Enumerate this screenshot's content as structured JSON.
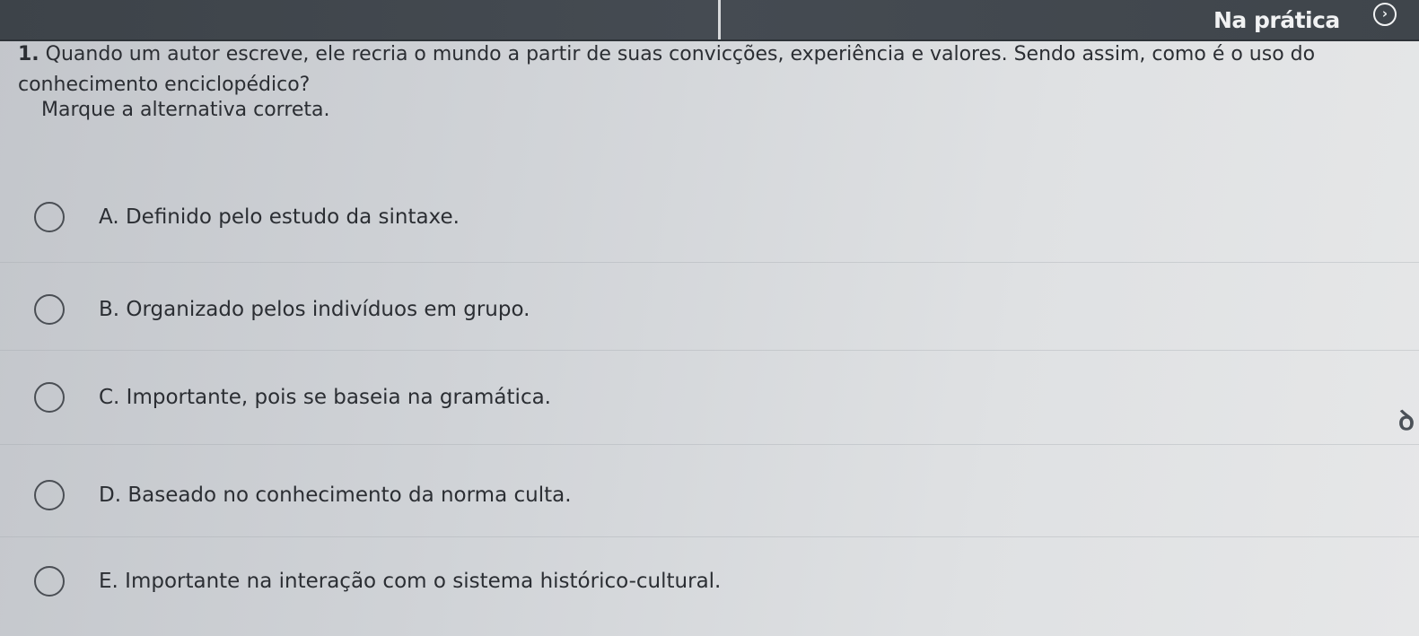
{
  "header": {
    "tab_label": "Na prática",
    "next_icon": "chevron-right-icon"
  },
  "question": {
    "number": "1.",
    "text": "Quando um autor escreve, ele recria o mundo a partir de suas convicções, experiência e valores. Sendo assim, como é o uso do conhecimento enciclopédico?",
    "instruction": "Marque a alternativa correta."
  },
  "options": [
    {
      "label": "A. Definido pelo estudo da sintaxe."
    },
    {
      "label": "B. Organizado pelos indivíduos em grupo."
    },
    {
      "label": "C. Importante, pois se baseia na gramática."
    },
    {
      "label": "D. Baseado no conhecimento da norma culta."
    },
    {
      "label": "E. Importante na interação com o sistema histórico-cultural."
    }
  ],
  "side_icon": "accessibility-icon"
}
